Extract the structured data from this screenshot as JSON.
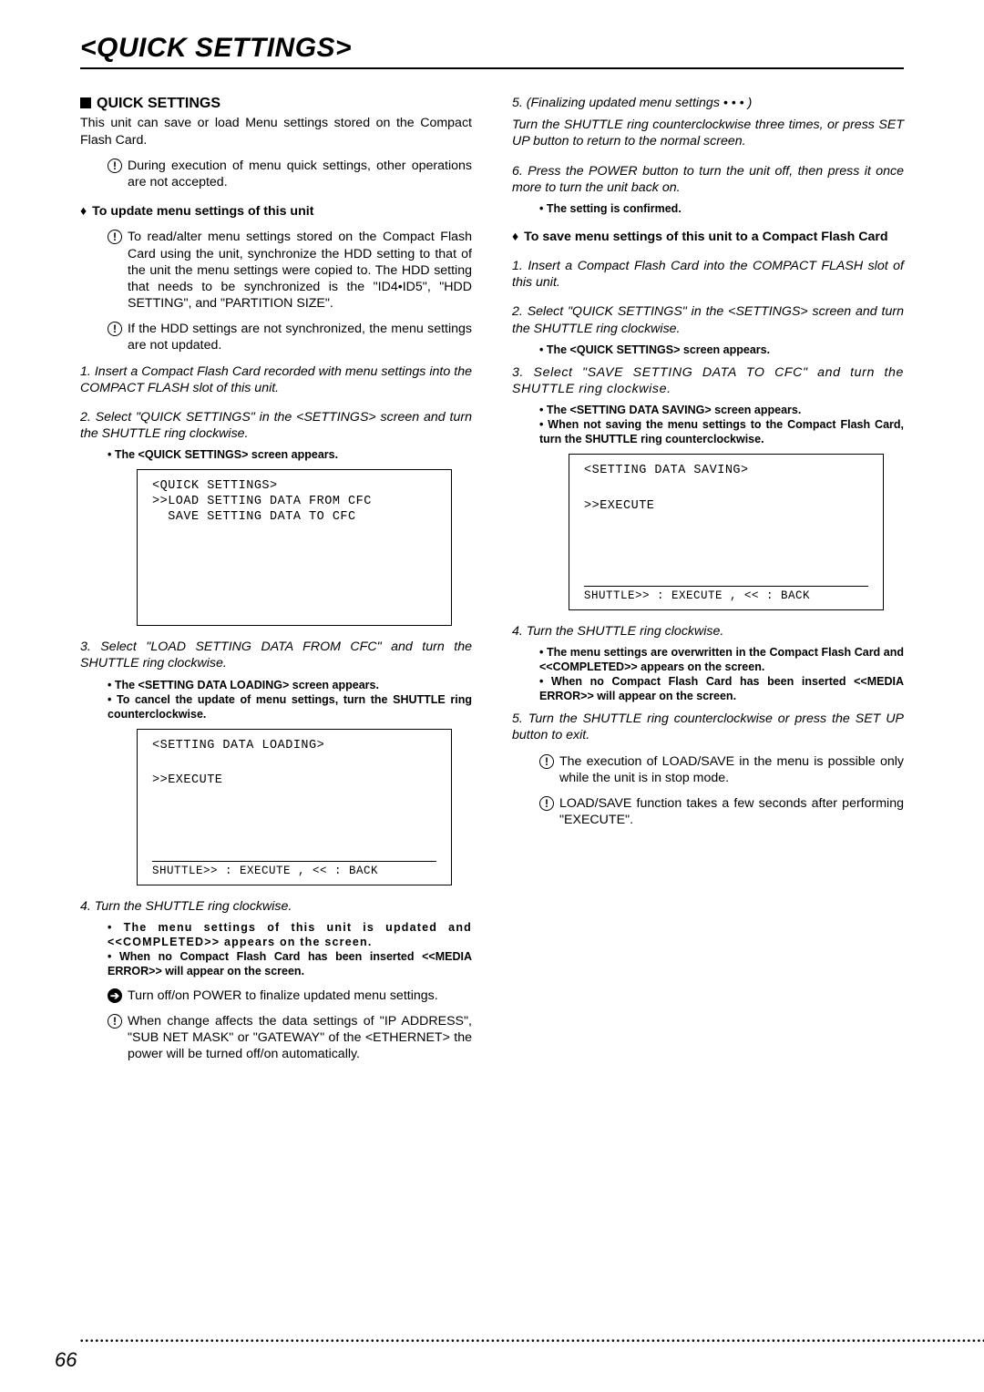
{
  "page_title": "<QUICK SETTINGS>",
  "page_number": "66",
  "left": {
    "heading": "QUICK SETTINGS",
    "intro": "This unit can save or load Menu settings stored on the Compact Flash Card.",
    "warn1": "During execution of menu quick settings, other operations are not accepted.",
    "sub1": "To update menu settings of this unit",
    "warn2": "To read/alter menu settings stored on the Compact Flash Card using the unit, synchronize the HDD setting to that of the unit the menu settings were copied to. The HDD setting that needs to be synchronized is the \"ID4•ID5\", \"HDD SETTING\", and \"PARTITION SIZE\".",
    "warn3": "If the HDD settings are not synchronized, the menu settings are not updated.",
    "step1": "1. Insert a Compact Flash Card recorded with menu settings into the COMPACT FLASH slot of this unit.",
    "step2": "2. Select \"QUICK SETTINGS\" in the <SETTINGS> screen and turn the SHUTTLE ring clockwise.",
    "step2b": "• The <QUICK SETTINGS> screen appears.",
    "screen1": {
      "title": "<QUICK SETTINGS>",
      "line1": ">>LOAD SETTING DATA FROM CFC",
      "line2": "  SAVE SETTING DATA TO CFC"
    },
    "step3": "3. Select \"LOAD SETTING DATA FROM CFC\" and turn the SHUTTLE ring clockwise.",
    "step3b1": "• The <SETTING DATA LOADING> screen appears.",
    "step3b2": "• To cancel the update of menu settings, turn the SHUTTLE ring counterclockwise.",
    "screen2": {
      "title": "<SETTING DATA LOADING>",
      "exec": ">>EXECUTE",
      "footer": "SHUTTLE>> : EXECUTE , << : BACK"
    },
    "step4": "4. Turn the SHUTTLE ring clockwise.",
    "step4b1": "• The menu settings of this unit is updated and <<COMPLETED>> appears on the screen.",
    "step4b2": "• When no Compact Flash Card has been inserted <<MEDIA ERROR>> will appear on the screen.",
    "tip1": "Turn off/on POWER to finalize updated menu settings.",
    "warn4": "When change affects the data settings of \"IP ADDRESS\", \"SUB NET MASK\" or \"GATEWAY\" of the <ETHERNET> the power will be turned off/on automatically."
  },
  "right": {
    "step5": "5. (Finalizing updated menu settings • • • )",
    "step5b": "Turn the SHUTTLE ring counterclockwise three times, or press SET UP button to return to the normal screen.",
    "step6": "6. Press the POWER button to turn the unit off, then press it once more to turn the unit back on.",
    "step6b": "• The setting is confirmed.",
    "sub2": "To save menu settings of this unit to a Compact Flash Card",
    "s1": "1. Insert a Compact Flash Card into the COMPACT FLASH slot of this unit.",
    "s2": "2. Select \"QUICK SETTINGS\" in the <SETTINGS> screen and turn the SHUTTLE ring clockwise.",
    "s2b": "• The <QUICK SETTINGS> screen appears.",
    "s3": "3. Select \"SAVE SETTING DATA TO CFC\" and turn the SHUTTLE ring clockwise.",
    "s3b1": "• The <SETTING DATA SAVING> screen appears.",
    "s3b2": "• When not saving the menu settings to the Compact Flash Card, turn the SHUTTLE ring counterclockwise.",
    "screen3": {
      "title": "<SETTING DATA SAVING>",
      "exec": ">>EXECUTE",
      "footer": "SHUTTLE>> : EXECUTE , << : BACK"
    },
    "s4": "4. Turn the SHUTTLE ring clockwise.",
    "s4b1": "• The menu settings are overwritten in the Compact Flash Card and <<COMPLETED>> appears on the screen.",
    "s4b2": "• When no Compact Flash Card has been inserted <<MEDIA ERROR>> will appear on the screen.",
    "s5": "5. Turn the SHUTTLE ring counterclockwise or press the SET UP button to exit.",
    "warn5": "The execution of LOAD/SAVE in the menu is possible only while the unit is in stop mode.",
    "warn6": "LOAD/SAVE function takes a few seconds after performing \"EXECUTE\"."
  }
}
